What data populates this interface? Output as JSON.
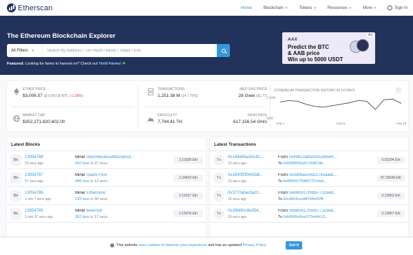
{
  "header": {
    "logo_text": "Etherscan",
    "nav": [
      {
        "label": "Home",
        "active": true
      },
      {
        "label": "Blockchain",
        "dropdown": true
      },
      {
        "label": "Tokens",
        "dropdown": true
      },
      {
        "label": "Resources",
        "dropdown": true
      },
      {
        "label": "More",
        "dropdown": true
      },
      {
        "label": "Sign In"
      }
    ]
  },
  "hero": {
    "title": "The Ethereum Blockchain Explorer",
    "filter_label": "All Filters",
    "search_placeholder": "Search by Address / Txn Hash / Block / Token / Ens",
    "featured_label": "Featured:",
    "featured_text": "Looking for farms to harvest on? Check out",
    "featured_link": "Yield Farms!"
  },
  "ad": {
    "tag": "Ad",
    "brand": "AAX",
    "line1": "Predict the BTC",
    "line2": "& AAB price",
    "line3": "Win up to 5000 USDT"
  },
  "stats": {
    "ether_price_label": "ETHER PRICE",
    "ether_price_value": "$3,006.57",
    "ether_price_btc": "@ 0.06718 BTC",
    "ether_price_change": "(-1.58%)",
    "market_cap_label": "MARKET CAP",
    "market_cap_value": "$352,271,820,602.00",
    "transactions_label": "TRANSACTIONS",
    "transactions_value": "1,251.38 M",
    "transactions_tps": "(14.7 TPS)",
    "gas_label": "MED GAS PRICE",
    "gas_value": "28 Gwei",
    "gas_usd": "($1.77)",
    "difficulty_label": "DIFFICULTY",
    "difficulty_value": "7,794.41 TH",
    "hashrate_label": "HASH RATE",
    "hashrate_value": "617,156.54 GH/s"
  },
  "chart_data": {
    "type": "line",
    "title": "ETHEREUM TRANSACTION HISTORY IN 14 DAYS",
    "x": [
      "Aug 4",
      "Aug 5",
      "Aug 6",
      "Aug 7",
      "Aug 8",
      "Aug 9",
      "Aug 10",
      "Aug 11",
      "Aug 12",
      "Aug 13",
      "Aug 14",
      "Aug 15",
      "Aug 16",
      "Aug 17",
      "Aug 18"
    ],
    "values": [
      1180000,
      1200000,
      1190000,
      1150000,
      1120000,
      1110000,
      1130000,
      1150000,
      1170000,
      1200000,
      1190000,
      1080000,
      1210000,
      1220000,
      1160000
    ],
    "x_ticks": [
      "Aug 4",
      "Aug 11",
      "Aug 18"
    ],
    "y_ticks": [
      "960k",
      "1 240k"
    ],
    "ylim": [
      960000,
      1240000
    ]
  },
  "latest_blocks": {
    "title": "Latest Blocks",
    "badge": "Bk",
    "miner_label": "Miner",
    "rows": [
      {
        "block": "13054788",
        "age": "20 secs ago",
        "miner": "0xe206e3dca498256f1b...",
        "txns": "242 txns",
        "txns_time": "in 37 secs",
        "reward": "2.10208 Eth"
      },
      {
        "block": "13054787",
        "age": "57 secs ago",
        "miner": "Spark Pool",
        "txns": "448 txns",
        "txns_time": "in 13 secs",
        "reward": "2.34503 Eth"
      },
      {
        "block": "13054786",
        "age": "1 min 7 secs ago",
        "miner": "Ethermine",
        "txns": "133 txns",
        "txns_time": "in 30 secs",
        "reward": "2.19167 Eth"
      },
      {
        "block": "13054785",
        "age": "1 min 37 secs ago",
        "miner": "BeePool",
        "txns": "352 txns",
        "txns_time": "in 17 secs",
        "reward": "2.15478 Eth"
      }
    ]
  },
  "latest_transactions": {
    "title": "Latest Transactions",
    "badge": "Tx",
    "from_label": "From",
    "to_label": "To",
    "rows": [
      {
        "hash": "0x149d46a34142...",
        "age": "19 secs ago",
        "from": "0x49b21bdfa303338589...",
        "to": "0x5088936a97c5d87db...",
        "amount": "0.02294 Eth"
      },
      {
        "hash": "0x1630f2f0443d6...",
        "age": "19 secs ago",
        "from": "0x3d06a5c4dc17e0aadc...",
        "to": "0x8f80017f0fd5772c5eb...",
        "amount": "87.29249 Eth"
      },
      {
        "hash": "0x3770afee3a20...",
        "age": "19 secs ago",
        "from": "0x8f80017f0fd5772c5eb...",
        "to": "0xc4b63cecbff194e91fff...",
        "amount": "0.12863 Eth"
      },
      {
        "hash": "0x1f6490c9e354...",
        "age": "19 secs ago",
        "from": "0x8f80017f0fd5772c5eb...",
        "to": "0xb866ba5ee372e44c13...",
        "amount": "0.12867 Eth"
      }
    ]
  },
  "cookie": {
    "text_before": "This website",
    "link1": "uses cookies to improve your experience",
    "text_middle": "and has an updated",
    "link2": "Privacy Policy",
    "button": "Got It"
  }
}
